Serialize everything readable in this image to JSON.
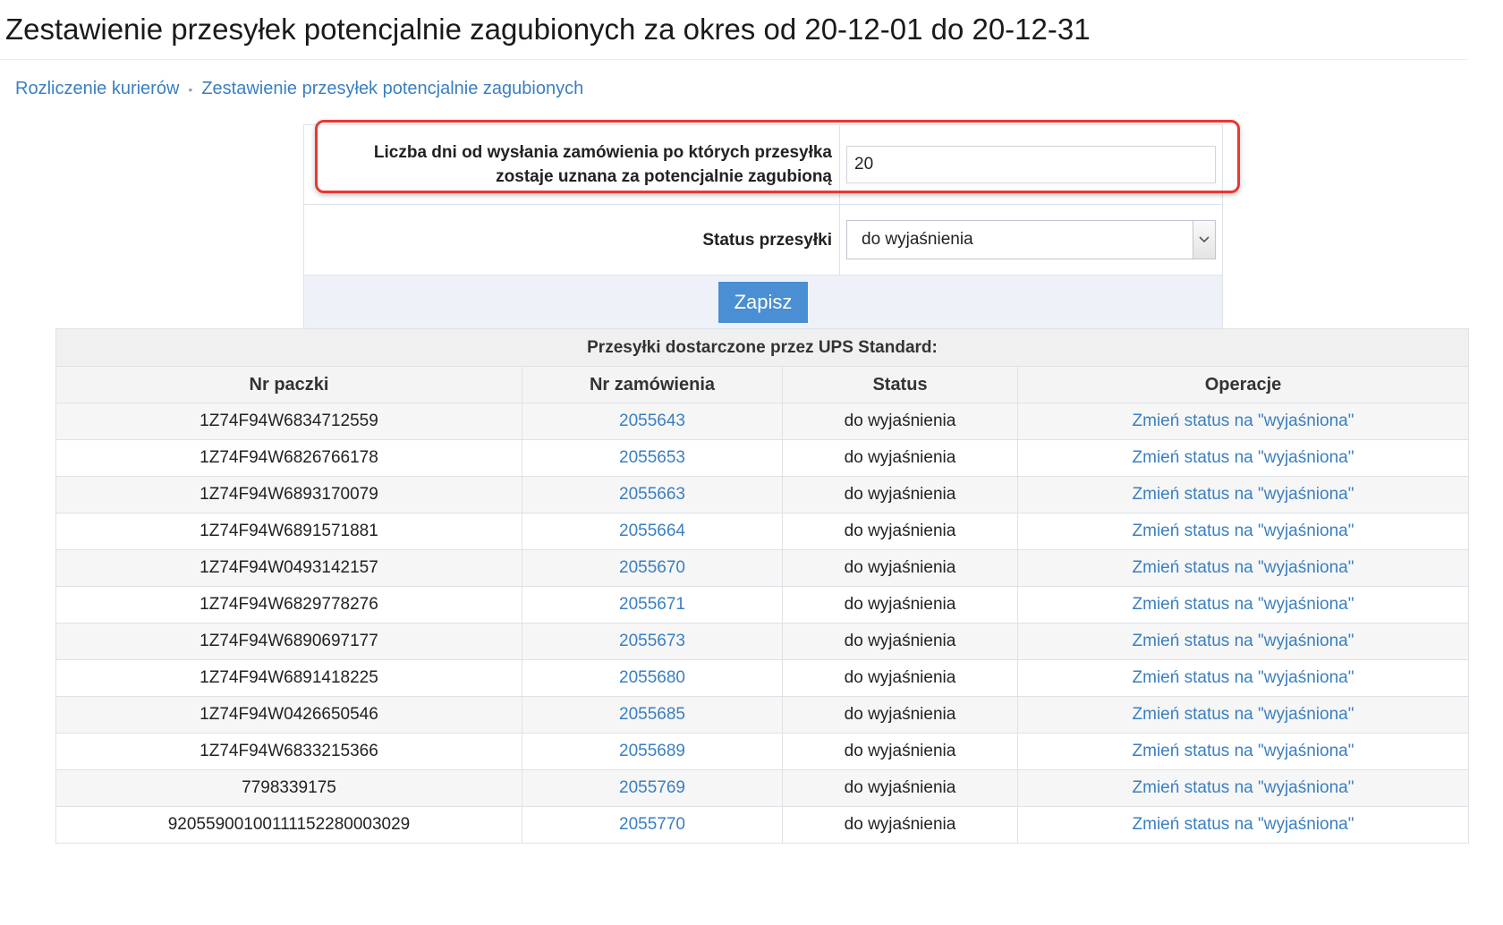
{
  "page": {
    "title": "Zestawienie przesyłek potencjalnie zagubionych za okres od 20-12-01 do 20-12-31"
  },
  "breadcrumb": {
    "items": [
      "Rozliczenie kurierów",
      "Zestawienie przesyłek potencjalnie zagubionych"
    ],
    "separator": "•"
  },
  "settings": {
    "days_label_line1": "Liczba dni od wysłania zamówienia po których przesyłka",
    "days_label_line2": "zostaje uznana za potencjalnie zagubioną",
    "days_value": "20",
    "status_label": "Status przesyłki",
    "status_value": "do wyjaśnienia",
    "submit_label": "Zapisz"
  },
  "results": {
    "caption": "Przesyłki dostarczone przez UPS Standard:",
    "columns": [
      "Nr paczki",
      "Nr zamówienia",
      "Status",
      "Operacje"
    ],
    "rows": [
      {
        "package": "1Z74F94W6834712559",
        "order": "2055643",
        "status": "do wyjaśnienia",
        "action": "Zmień status na \"wyjaśniona\""
      },
      {
        "package": "1Z74F94W6826766178",
        "order": "2055653",
        "status": "do wyjaśnienia",
        "action": "Zmień status na \"wyjaśniona\""
      },
      {
        "package": "1Z74F94W6893170079",
        "order": "2055663",
        "status": "do wyjaśnienia",
        "action": "Zmień status na \"wyjaśniona\""
      },
      {
        "package": "1Z74F94W6891571881",
        "order": "2055664",
        "status": "do wyjaśnienia",
        "action": "Zmień status na \"wyjaśniona\""
      },
      {
        "package": "1Z74F94W0493142157",
        "order": "2055670",
        "status": "do wyjaśnienia",
        "action": "Zmień status na \"wyjaśniona\""
      },
      {
        "package": "1Z74F94W6829778276",
        "order": "2055671",
        "status": "do wyjaśnienia",
        "action": "Zmień status na \"wyjaśniona\""
      },
      {
        "package": "1Z74F94W6890697177",
        "order": "2055673",
        "status": "do wyjaśnienia",
        "action": "Zmień status na \"wyjaśniona\""
      },
      {
        "package": "1Z74F94W6891418225",
        "order": "2055680",
        "status": "do wyjaśnienia",
        "action": "Zmień status na \"wyjaśniona\""
      },
      {
        "package": "1Z74F94W0426650546",
        "order": "2055685",
        "status": "do wyjaśnienia",
        "action": "Zmień status na \"wyjaśniona\""
      },
      {
        "package": "1Z74F94W6833215366",
        "order": "2055689",
        "status": "do wyjaśnienia",
        "action": "Zmień status na \"wyjaśniona\""
      },
      {
        "package": "7798339175",
        "order": "2055769",
        "status": "do wyjaśnienia",
        "action": "Zmień status na \"wyjaśniona\""
      },
      {
        "package": "92055900100111152280003029",
        "order": "2055770",
        "status": "do wyjaśnienia",
        "action": "Zmień status na \"wyjaśniona\""
      }
    ]
  },
  "colors": {
    "link": "#3a7fc1",
    "button": "#4a8ed3",
    "highlight": "#e53935"
  }
}
